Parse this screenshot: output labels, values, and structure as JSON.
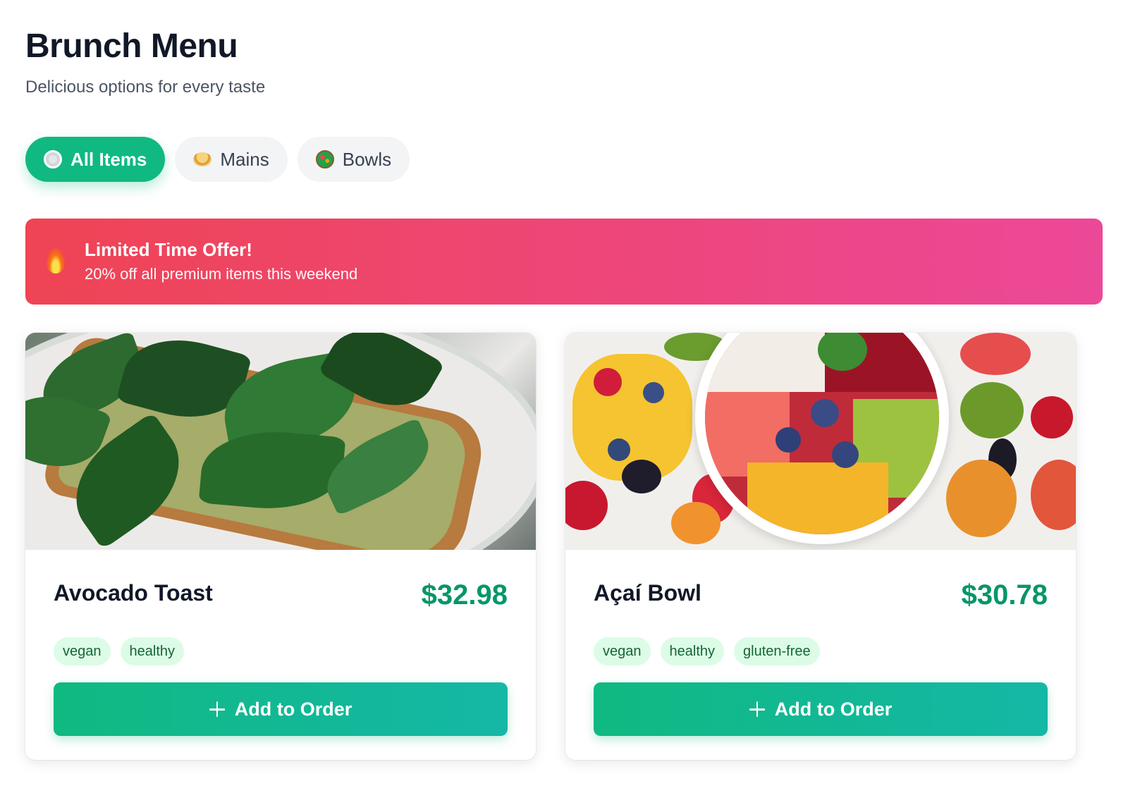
{
  "header": {
    "title": "Brunch Menu",
    "subtitle": "Delicious options for every taste"
  },
  "filters": [
    {
      "label": "All Items",
      "icon": "plate-icon",
      "active": true
    },
    {
      "label": "Mains",
      "icon": "pancakes-icon",
      "active": false
    },
    {
      "label": "Bowls",
      "icon": "salad-icon",
      "active": false
    }
  ],
  "banner": {
    "icon": "fire-icon",
    "title": "Limited Time Offer!",
    "text": "20% off all premium items this weekend"
  },
  "items": [
    {
      "name": "Avocado Toast",
      "price": "$32.98",
      "tags": [
        "vegan",
        "healthy"
      ],
      "button_label": "Add to Order"
    },
    {
      "name": "Açaí Bowl",
      "price": "$30.78",
      "tags": [
        "vegan",
        "healthy",
        "gluten-free"
      ],
      "button_label": "Add to Order"
    }
  ],
  "colors": {
    "accent": "#10b981",
    "price": "#059669",
    "banner_start": "#ef4454",
    "banner_end": "#ec4899",
    "tag_bg": "#dcfce7",
    "tag_text": "#166534"
  }
}
